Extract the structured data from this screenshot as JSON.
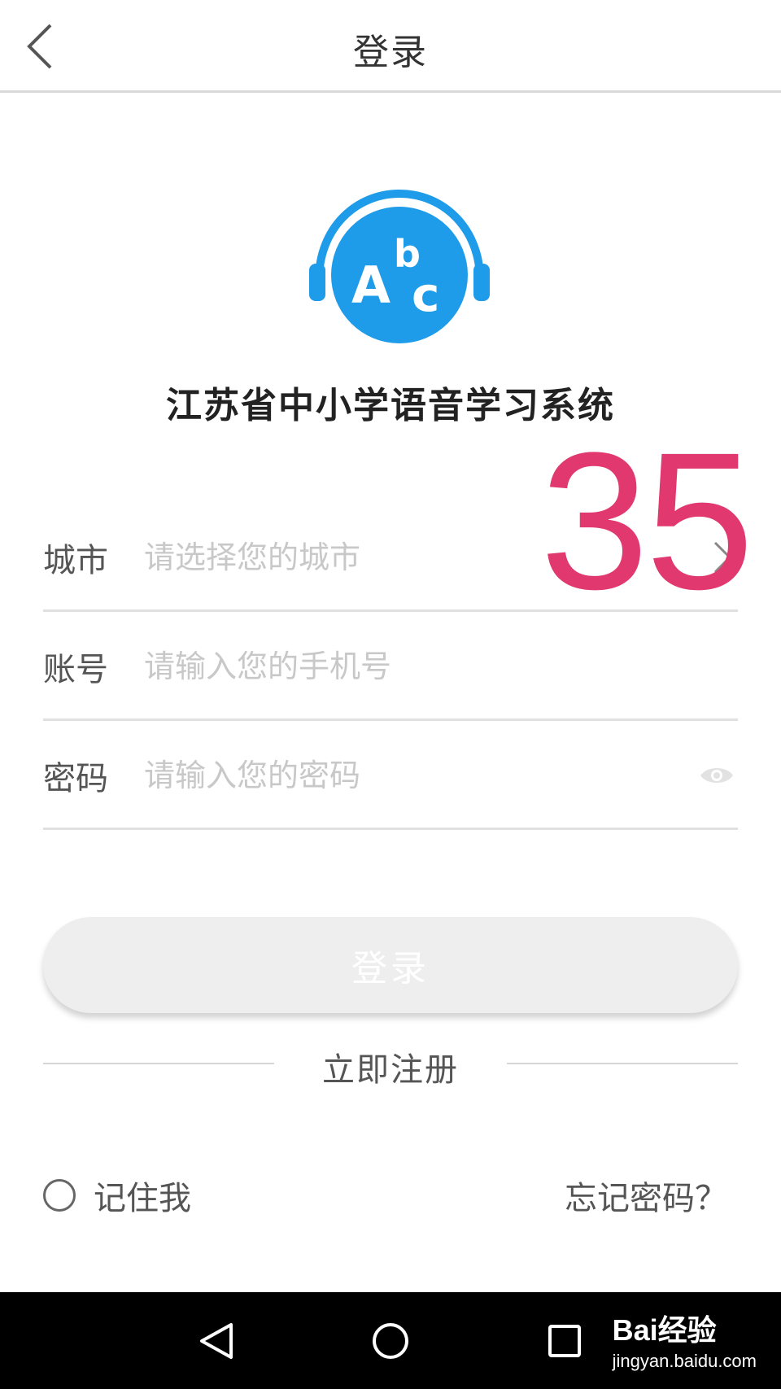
{
  "header": {
    "title": "登录"
  },
  "app": {
    "name": "江苏省中小学语音学习系统",
    "logo_letters": "Abc"
  },
  "watermark_number": "35",
  "form": {
    "city": {
      "label": "城市",
      "placeholder": "请选择您的城市"
    },
    "account": {
      "label": "账号",
      "placeholder": "请输入您的手机号"
    },
    "password": {
      "label": "密码",
      "placeholder": "请输入您的密码"
    }
  },
  "login_button": "登录",
  "register_link": "立即注册",
  "remember_me": "记住我",
  "forgot_password": "忘记密码？",
  "watermark": {
    "brand": "Bai经验",
    "url": "jingyan.baidu.com"
  },
  "colors": {
    "accent": "#2196f3",
    "watermark": "#e0386f",
    "button_bg": "#eeeeee"
  },
  "icons": [
    "back-arrow-icon",
    "chevron-right-icon",
    "eye-icon",
    "nav-back-icon",
    "nav-home-icon",
    "nav-recents-icon"
  ]
}
